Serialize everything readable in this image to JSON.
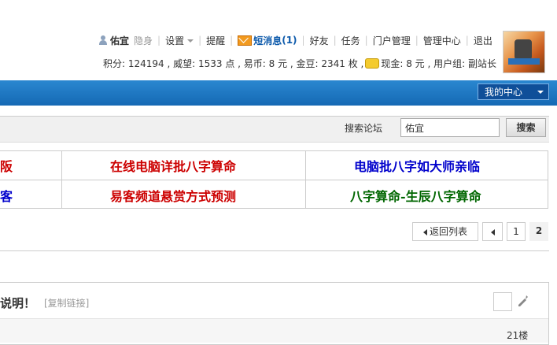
{
  "userbar": {
    "username": "佑宜",
    "invisible": "隐身",
    "settings": "设置",
    "reminder": "提醒",
    "messages": "短消息",
    "messages_count": "(1)",
    "friends": "好友",
    "tasks": "任务",
    "portal_admin": "门户管理",
    "admin_center": "管理中心",
    "logout": "退出"
  },
  "credits": {
    "text_before_coin": "积分: 124194 , 威望: 1533 点 , 易币: 8 元 , 金豆: 2341 枚 , ",
    "text_after_coin": "现金: 8 元 , 用户组: 副站长"
  },
  "nav": {
    "my_center": "我的中心"
  },
  "search": {
    "label": "搜索论坛",
    "value": "佑宜",
    "button": "搜索"
  },
  "ads": [
    {
      "text": "阪",
      "color": "#cc0000"
    },
    {
      "text": "在线电脑详批八字算命",
      "color": "#cc0000"
    },
    {
      "text": "电脑批八字如大师亲临",
      "color": "#0000cc"
    },
    {
      "text": "客",
      "color": "#0000cc"
    },
    {
      "text": "易客频道悬赏方式预测",
      "color": "#cc0000"
    },
    {
      "text": "八字算命-生辰八字算命",
      "color": "#006600"
    }
  ],
  "pager": {
    "back": "返回列表",
    "page1": "1",
    "page2": "2"
  },
  "post": {
    "title": "说明！",
    "copy_link": "[复制链接]",
    "floor": "21楼"
  },
  "icons": [
    "person-icon",
    "mail-icon",
    "coin-icon",
    "chevron-down-icon",
    "wrench-icon"
  ]
}
